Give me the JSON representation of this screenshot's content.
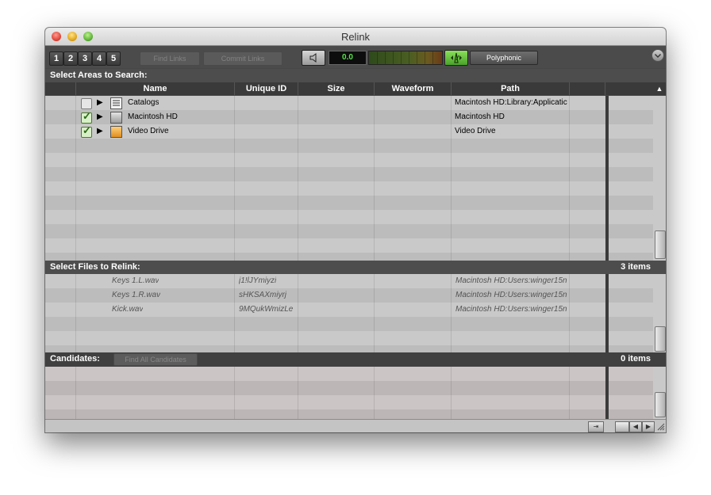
{
  "window": {
    "title": "Relink"
  },
  "toolbar": {
    "tabs": [
      "1",
      "2",
      "3",
      "4",
      "5"
    ],
    "find_links": "Find Links",
    "commit_links": "Commit Links",
    "counter": "0.0",
    "mode": "Polyphonic"
  },
  "search_section": {
    "label": "Select Areas to Search:",
    "columns": [
      "Name",
      "Unique ID",
      "Size",
      "Waveform",
      "Path"
    ],
    "rows": [
      {
        "checked": false,
        "icon": "catalog-icon",
        "name": "Catalogs",
        "path": "Macintosh HD:Library:Applicatic"
      },
      {
        "checked": true,
        "icon": "hard-drive-icon",
        "name": "Macintosh HD",
        "path": "Macintosh HD"
      },
      {
        "checked": true,
        "icon": "external-drive-icon",
        "name": "Video Drive",
        "path": "Video Drive"
      }
    ]
  },
  "relink_section": {
    "label": "Select Files to Relink:",
    "count": "3 items",
    "rows": [
      {
        "name": "Keys 1.L.wav",
        "id": "j1!lJYmiyzi",
        "path": "Macintosh HD:Users:winger15n"
      },
      {
        "name": "Keys 1.R.wav",
        "id": "sHKSAXmiyrj",
        "path": "Macintosh HD:Users:winger15n"
      },
      {
        "name": "Kick.wav",
        "id": "9MQukWmizLe",
        "path": "Macintosh HD:Users:winger15n"
      }
    ]
  },
  "candidates_section": {
    "label": "Candidates:",
    "find_all": "Find All Candidates",
    "count": "0 items"
  },
  "colors": {
    "row_gray_a": "#c9c9c9",
    "row_gray_b": "#bcbcbc",
    "row_pink_a": "#ccc5c6",
    "row_pink_b": "#bdb6b7",
    "accent_green": "#5fd24a"
  }
}
